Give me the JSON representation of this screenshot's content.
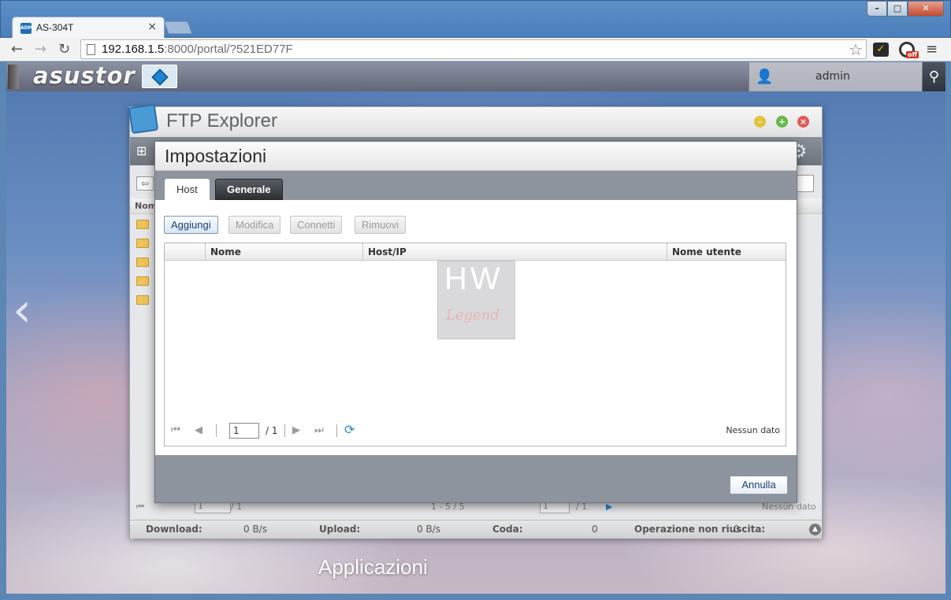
{
  "browser": {
    "tab_title": "AS-304T",
    "tab_favicon_text": "ADM",
    "url_host": "192.168.1.5",
    "url_rest": ":8000/portal/?521ED77F",
    "ext_badge": "off"
  },
  "adm": {
    "logo": "asustor",
    "user": "admin",
    "caption": "Applicazioni"
  },
  "ftp_window": {
    "title": "FTP Explorer",
    "column_name_fragment": "Nom",
    "pager_left": {
      "page": "1",
      "total": "/ 1",
      "range": "1 - 5 / 5"
    },
    "pager_right": {
      "page": "1",
      "total": "/ 1",
      "info": "Nessun dato"
    },
    "status": {
      "download_label": "Download:",
      "download_value": "0 B/s",
      "upload_label": "Upload:",
      "upload_value": "0 B/s",
      "queue_label": "Coda:",
      "queue_value": "0",
      "failed_label": "Operazione non riuscita:",
      "failed_value": "0"
    }
  },
  "dialog": {
    "title": "Impostazioni",
    "tabs": [
      {
        "label": "Host",
        "active": true
      },
      {
        "label": "Generale",
        "active": false
      }
    ],
    "buttons": {
      "add": "Aggiungi",
      "edit": "Modifica",
      "connect": "Connetti",
      "remove": "Rimuovi"
    },
    "columns": [
      "",
      "Nome",
      "Host/IP",
      "Nome utente"
    ],
    "watermark": {
      "top": "HW",
      "bottom": "Legend"
    },
    "pager": {
      "page": "1",
      "total": "/ 1",
      "info": "Nessun dato"
    },
    "cancel_label": "Annulla"
  }
}
